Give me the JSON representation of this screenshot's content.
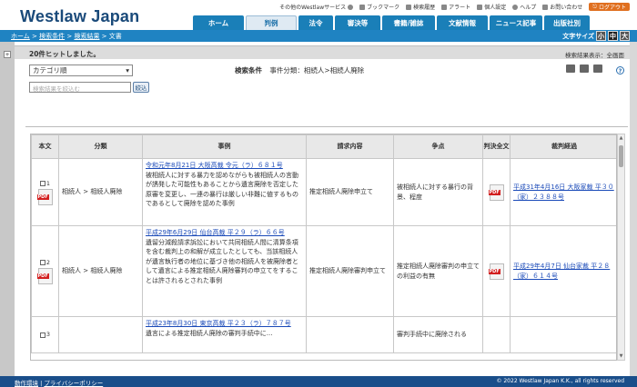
{
  "header": {
    "logo": "Westlaw Japan",
    "util": {
      "other_services": "その他のWestlawサービス",
      "bookmark": "ブックマーク",
      "history": "検索履歴",
      "alert": "アラート",
      "personal": "個人設定",
      "help": "ヘルプ",
      "inquiry": "お問い合わせ",
      "logout": "ログアウト"
    },
    "tabs": [
      "ホーム",
      "判例",
      "法令",
      "審決等",
      "書籍/雑誌",
      "文献情報",
      "ニュース記事",
      "出版社別"
    ],
    "active_tab": "判例"
  },
  "breadcrumb": {
    "home": "ホーム",
    "sep1": " > ",
    "conditions": "検索条件",
    "sep2": " > ",
    "results": "検索結果",
    "current": " > 文書"
  },
  "font_size": {
    "label": "文字サイズ",
    "small": "小",
    "medium": "中",
    "large": "大"
  },
  "results_bar": {
    "hits": "20件ヒットしました。",
    "display_mode": "検索結果表示：全画面"
  },
  "controls": {
    "sort_value": "カテゴリ順",
    "narrow_placeholder": "検索結果を絞込む",
    "narrow_button": "絞込",
    "condition_label": "検索条件",
    "condition_value": "事件分類：相続人>相続人廃除"
  },
  "table": {
    "headers": [
      "本文",
      "分類",
      "事例",
      "請求内容",
      "争点",
      "判決全文",
      "裁判経過"
    ],
    "rows": [
      {
        "num": "1",
        "category": "相続人 > 相続人廃除",
        "case_link": "令和元年8月21日 大阪高裁 令元（ラ）６８１号",
        "case_text": "被相続人に対する暴力を認めながらも被相続人の言動が誘発した可能性もあることから遺言廃除を否定した原審を変更し、一連の暴行は厳しい非難に値するものであるとして廃除を認めた事例",
        "claim": "推定相続人廃除申立て",
        "issue": "被相続人に対する暴行の背景、程度",
        "history": "平成31年4月16日 大阪家裁 平３０（家）２３８８号"
      },
      {
        "num": "2",
        "category": "相続人 > 相続人廃除",
        "case_link": "平成29年6月29日 仙台高裁 平２９（ラ）６６号",
        "case_text": "遺留分減殺請求訴訟において共同相続人間に清算条項を含む裁判上の和解が成立したとしても、当該相続人が遺言執行者の地位に基づき他の相続人を被廃除者として遺言による推定相続人廃除審判の申立てをすることは許されるとされた事例",
        "claim": "推定相続人廃除審判申立て",
        "issue": "推定相続人廃除審判の申立ての利益の有無",
        "history": "平成29年4月7日 仙台家裁 平２８（家）６１４号"
      },
      {
        "num": "3",
        "category": "",
        "case_link": "平成23年8月30日 東京高裁 平２３（ラ）７８７号",
        "case_text": "遺言による推定相続人廃除の審判手続中に...",
        "claim": "",
        "issue": "審判手続中に廃除される",
        "history": ""
      }
    ]
  },
  "footer": {
    "env": "動作環境",
    "sep": " | ",
    "privacy": "プライバシーポリシー",
    "copyright": "© 2022 Westlaw Japan K.K., all rights reserved"
  },
  "colors": {
    "nav_blue": "#1a7fb8",
    "breadcrumb_bar": "#1f83c2",
    "footer": "#1a4e8a",
    "logout": "#e07020",
    "link": "#1a4ab8"
  }
}
